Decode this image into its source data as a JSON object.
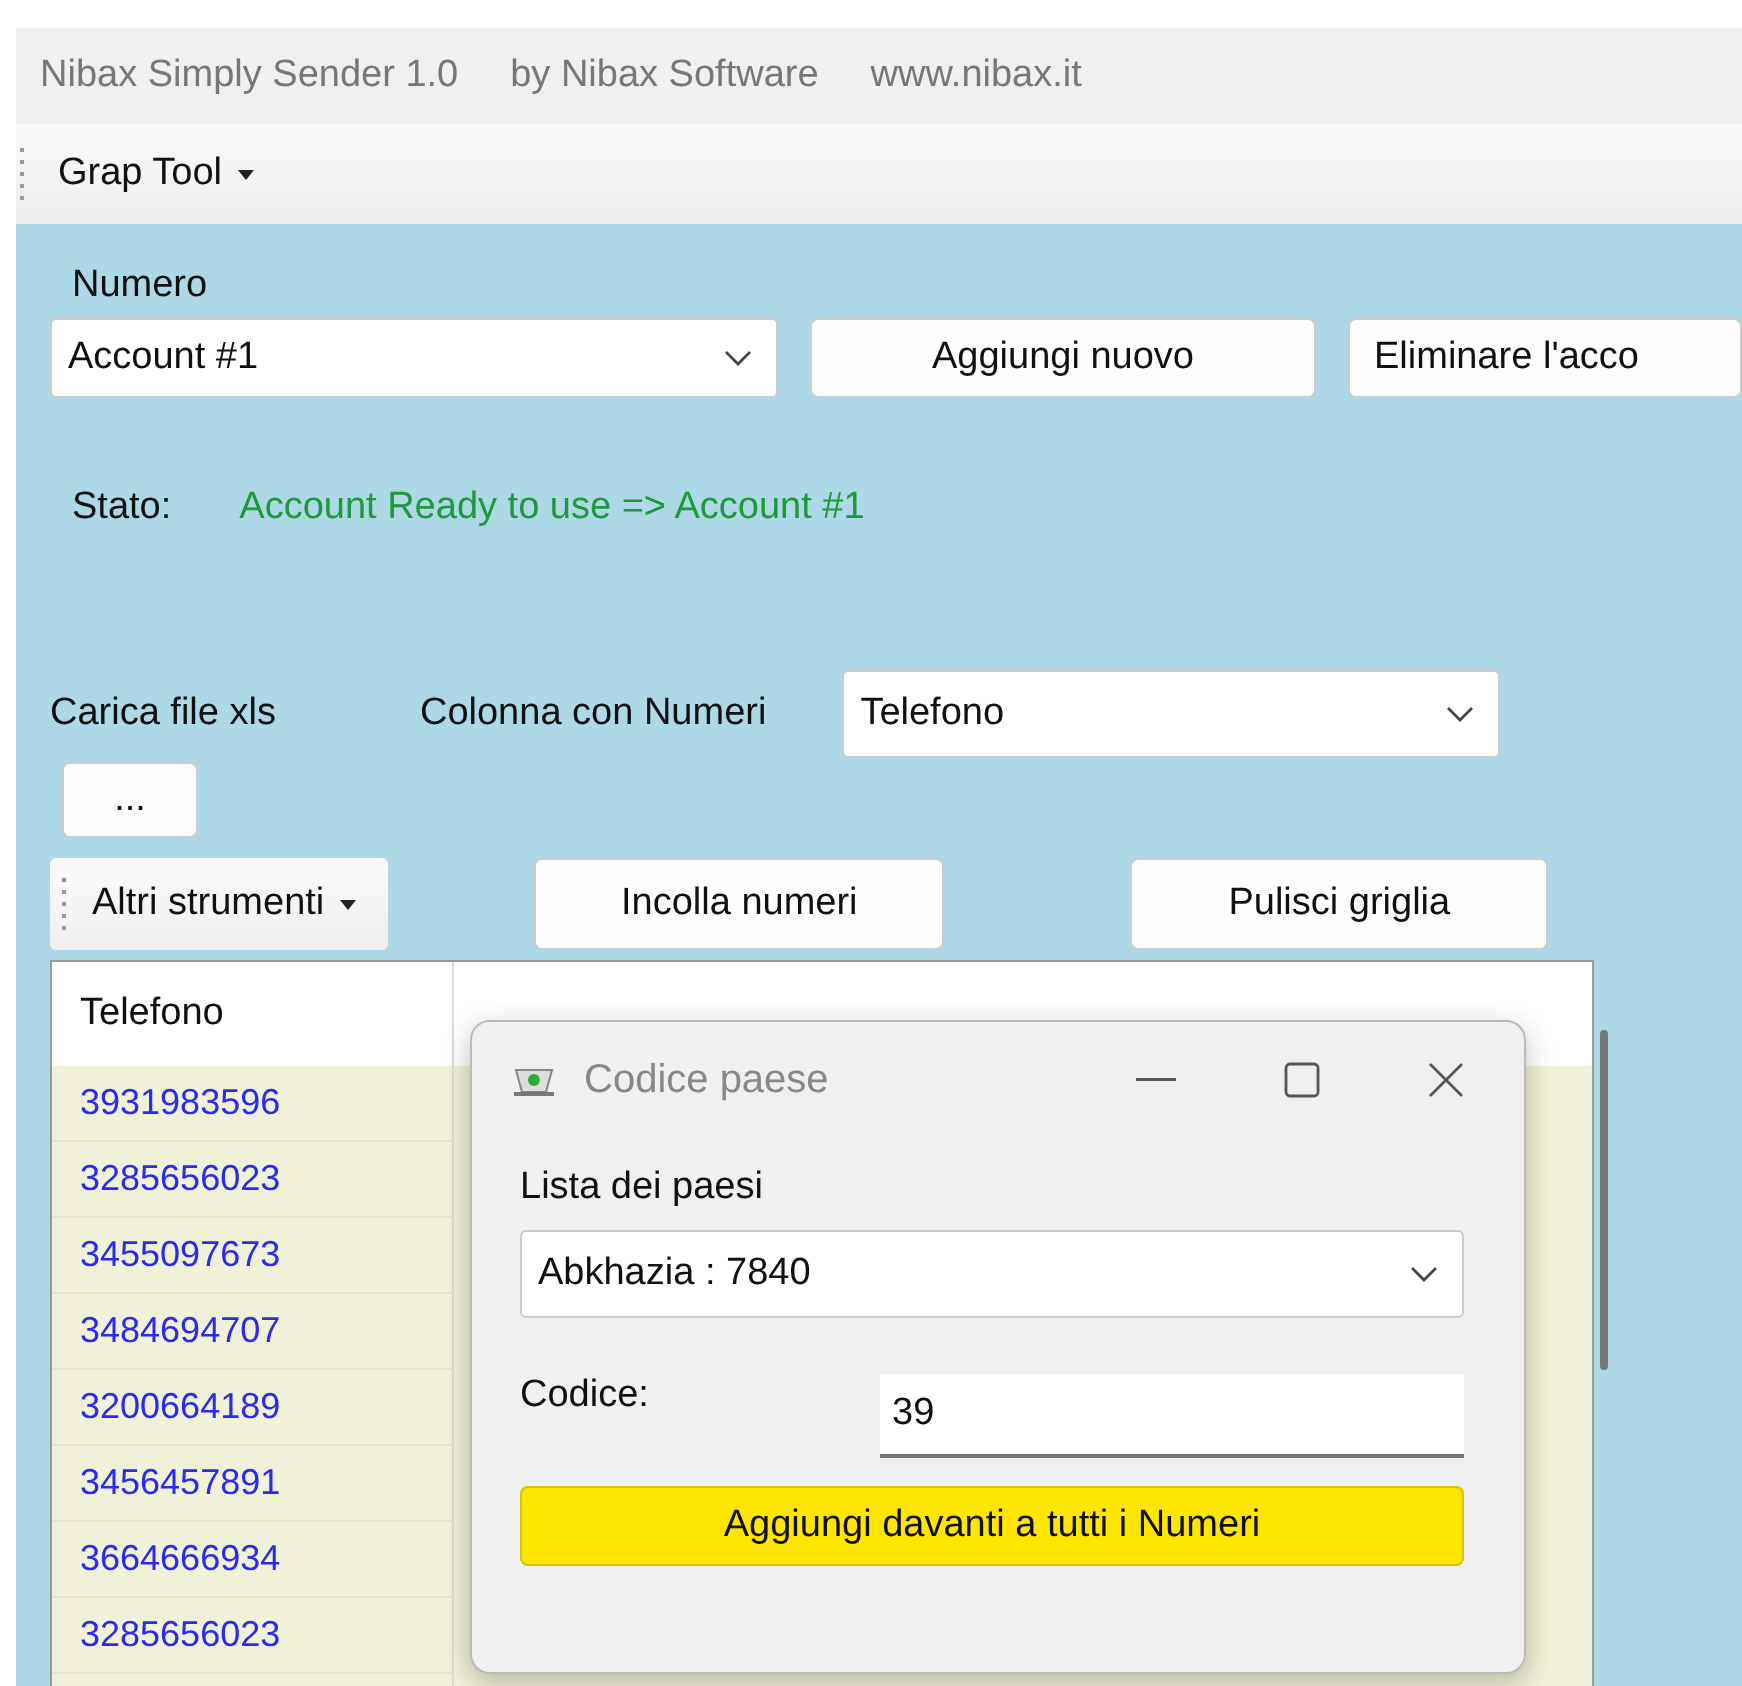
{
  "window": {
    "title_parts": [
      "Nibax Simply Sender 1.0",
      "by Nibax Software",
      "www.nibax.it"
    ]
  },
  "toolbar": {
    "menu": "Grap Tool"
  },
  "account": {
    "label": "Numero",
    "value": "Account #1",
    "buttons": [
      "Aggiungi nuovo",
      "Eliminare l'acco"
    ]
  },
  "status": {
    "label": "Stato:",
    "value": "Account Ready to use => Account #1"
  },
  "file": {
    "label": "Carica file xls",
    "browse": "...",
    "column_label": "Colonna con Numeri",
    "column_value": "Telefono"
  },
  "tools": {
    "menu": "Altri strumenti",
    "buttons": [
      "Incolla numeri",
      "Pulisci griglia"
    ]
  },
  "table": {
    "columns": [
      "Telefono"
    ],
    "rows": [
      "3931983596",
      "3285656023",
      "3455097673",
      "3484694707",
      "3200664189",
      "3456457891",
      "3664666934",
      "3285656023"
    ]
  },
  "dialog": {
    "title": "Codice paese",
    "list_label": "Lista dei paesi",
    "country": "Abkhazia : 7840",
    "code_label": "Codice:",
    "code_value": "39",
    "button": "Aggiungi davanti a tutti i Numeri"
  }
}
